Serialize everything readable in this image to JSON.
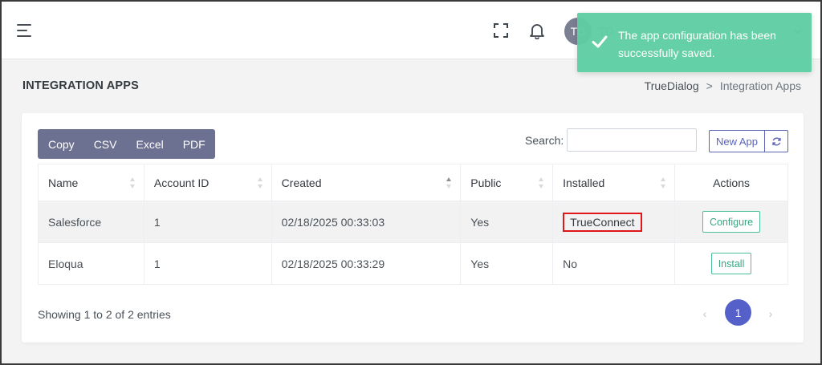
{
  "header": {
    "avatar_initials": "TD",
    "user_name": "TD"
  },
  "toast": {
    "message": "The app configuration has been successfully saved."
  },
  "page": {
    "title": "INTEGRATION APPS",
    "breadcrumb": {
      "root": "TrueDialog",
      "separator": ">",
      "current": "Integration Apps"
    }
  },
  "toolbar": {
    "export_buttons": [
      "Copy",
      "CSV",
      "Excel",
      "PDF"
    ],
    "search_label": "Search:",
    "search_value": "",
    "new_app_label": "New App"
  },
  "table": {
    "columns": [
      "Name",
      "Account ID",
      "Created",
      "Public",
      "Installed",
      "Actions"
    ],
    "rows": [
      {
        "name": "Salesforce",
        "account_id": "1",
        "created": "02/18/2025 00:33:03",
        "public": "Yes",
        "installed": "TrueConnect",
        "action": "Configure"
      },
      {
        "name": "Eloqua",
        "account_id": "1",
        "created": "02/18/2025 00:33:29",
        "public": "Yes",
        "installed": "No",
        "action": "Install"
      }
    ]
  },
  "footer": {
    "info": "Showing 1 to 2 of 2 entries",
    "prev": "‹",
    "current_page": "1",
    "next": "›"
  },
  "colors": {
    "accent": "#5660c9",
    "toast": "#5fcfa4",
    "export_bg": "#6c7191",
    "highlight": "#e0161b"
  }
}
